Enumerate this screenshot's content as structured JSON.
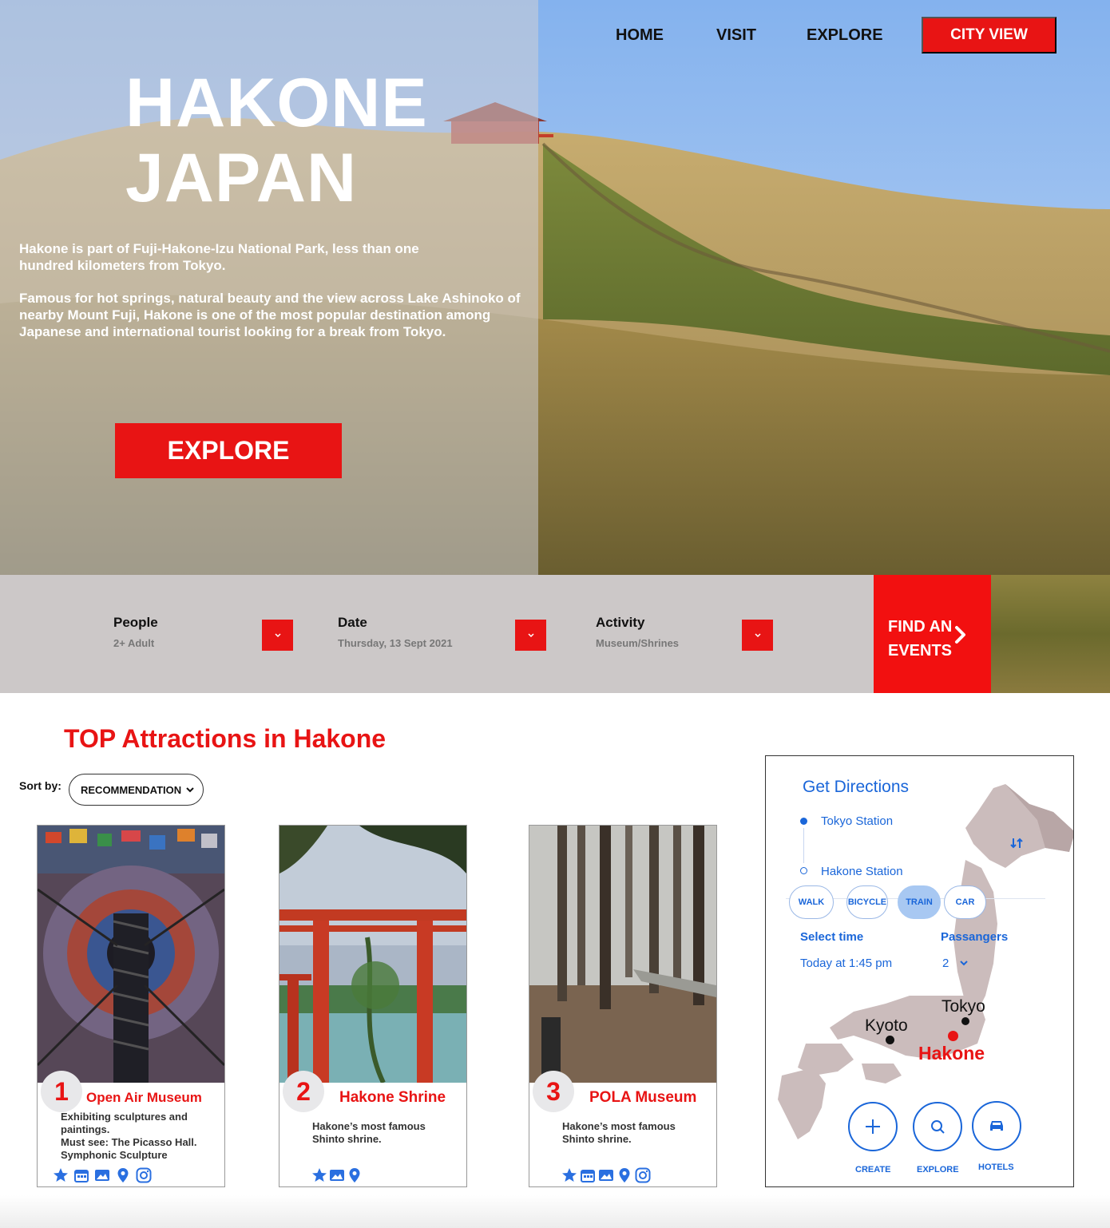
{
  "nav": {
    "home": "HOME",
    "visit": "VISIT",
    "explore": "EXPLORE",
    "city_view": "CITY VIEW"
  },
  "hero": {
    "title_line1": "HAKONE",
    "title_line2": "JAPAN",
    "paragraph1": "Hakone is part of Fuji-Hakone-Izu National Park, less than one hundred kilometers from Tokyo.",
    "paragraph2": "Famous for hot springs, natural beauty and the view across Lake Ashinoko of nearby Mount Fuji, Hakone is one of the most popular destination among Japanese and international tourist looking for a break from Tokyo.",
    "explore_button": "EXPLORE"
  },
  "search": {
    "people": {
      "label": "People",
      "value": "2+ Adult"
    },
    "date": {
      "label": "Date",
      "value": "Thursday, 13 Sept 2021"
    },
    "activity": {
      "label": "Activity",
      "value": "Museum/Shrines"
    },
    "find_line1": "FIND AN",
    "find_line2": "EVENTS"
  },
  "attractions": {
    "title": "TOP Attractions in Hakone",
    "sort_label": "Sort by:",
    "sort_value": "RECOMMENDATION",
    "cards": [
      {
        "number": "1",
        "title": "Open Air Museum",
        "desc_line1": "Exhibiting sculptures and",
        "desc_line2": "paintings.",
        "desc_line3": "Must see: The Picasso Hall.",
        "desc_line4": "Symphonic Sculpture"
      },
      {
        "number": "2",
        "title": "Hakone Shrine",
        "desc_line1": "Hakone’s most famous",
        "desc_line2": "Shinto shrine."
      },
      {
        "number": "3",
        "title": "POLA Museum",
        "desc_line1": "Hakone’s most famous",
        "desc_line2": "Shinto shrine."
      }
    ]
  },
  "directions": {
    "title": "Get Directions",
    "from": "Tokyo Station",
    "to": "Hakone Station",
    "modes": [
      "WALK",
      "BICYCLE",
      "TRAIN",
      "CAR"
    ],
    "active_mode": "TRAIN",
    "select_time_label": "Select time",
    "select_time_value": "Today at 1:45 pm",
    "passengers_label": "Passangers",
    "passengers_value": "2",
    "map_labels": {
      "tokyo": "Tokyo",
      "kyoto": "Kyoto",
      "hakone": "Hakone"
    },
    "actions": {
      "create": "CREATE",
      "explore": "EXPLORE",
      "hotels": "HOTELS"
    }
  },
  "colors": {
    "accent_red": "#e81414",
    "link_blue": "#1a66d9",
    "bar_gray": "#ccc8c8"
  }
}
